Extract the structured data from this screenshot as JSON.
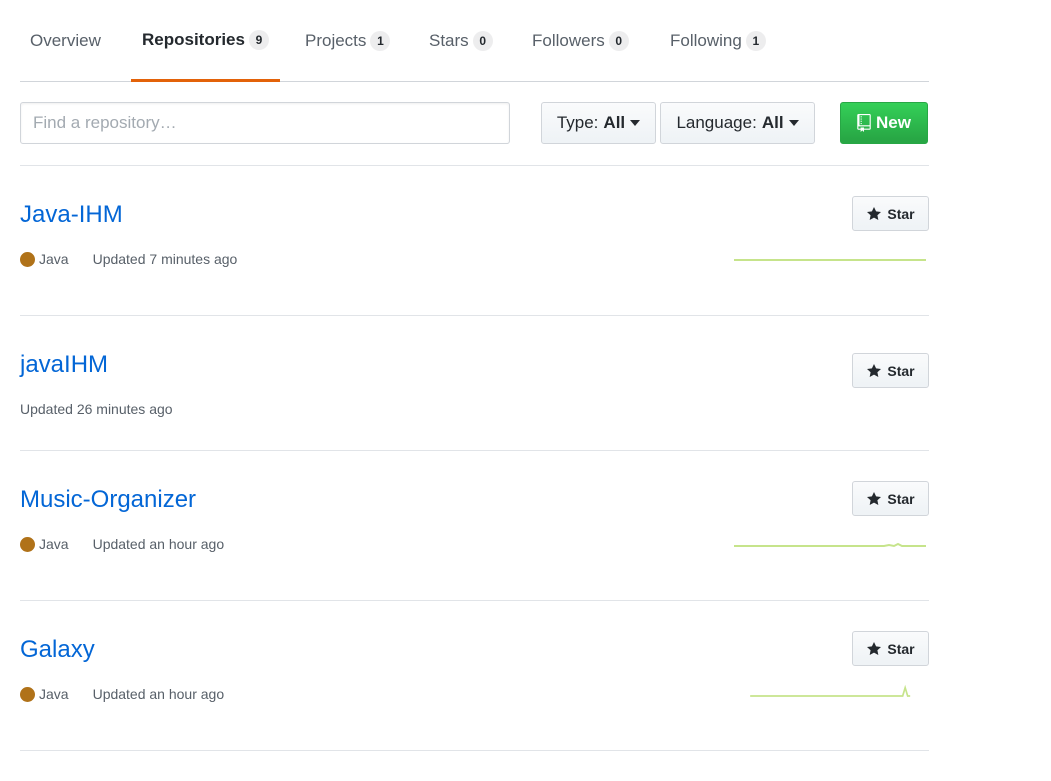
{
  "tabs": [
    {
      "label": "Overview",
      "count": null
    },
    {
      "label": "Repositories",
      "count": "9"
    },
    {
      "label": "Projects",
      "count": "1"
    },
    {
      "label": "Stars",
      "count": "0"
    },
    {
      "label": "Followers",
      "count": "0"
    },
    {
      "label": "Following",
      "count": "1"
    }
  ],
  "filters": {
    "search_placeholder": "Find a repository…",
    "type_prefix": "Type:",
    "type_value": "All",
    "language_prefix": "Language:",
    "language_value": "All",
    "new_label": "New"
  },
  "repos": [
    {
      "name": "Java-IHM",
      "language": "Java",
      "updated": "Updated 7 minutes ago",
      "star_label": "Star"
    },
    {
      "name": "javaIHM",
      "language": null,
      "updated": "Updated 26 minutes ago",
      "star_label": "Star"
    },
    {
      "name": "Music-Organizer",
      "language": "Java",
      "updated": "Updated an hour ago",
      "star_label": "Star"
    },
    {
      "name": "Galaxy",
      "language": "Java",
      "updated": "Updated an hour ago",
      "star_label": "Star"
    }
  ],
  "colors": {
    "accent_tab": "#e36209",
    "link": "#0366d6",
    "java_dot": "#b07219",
    "new_button": "#28a745",
    "sparkline": "#c6e48b"
  },
  "icons": {
    "star": "star-icon",
    "repo": "repo-icon",
    "caret": "caret-down-icon"
  }
}
